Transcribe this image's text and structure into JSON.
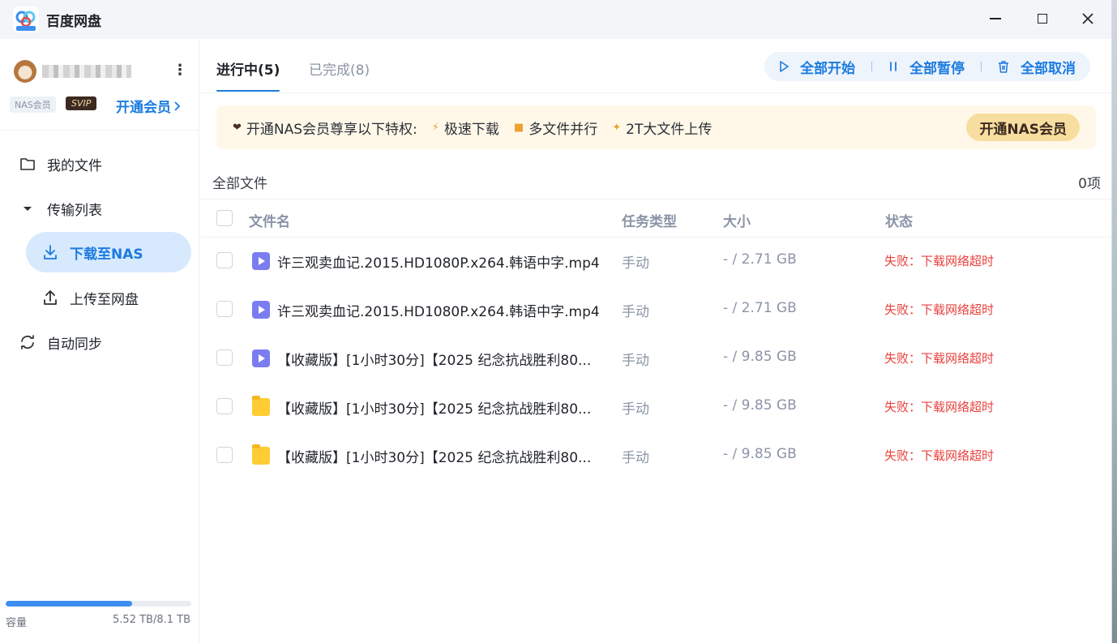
{
  "app": {
    "title": "百度网盘"
  },
  "user": {
    "badge_nas": "NAS会员",
    "badge_svip": "SVIP",
    "vip_link": "开通会员"
  },
  "sidebar": {
    "items": [
      {
        "label": "我的文件",
        "icon": "folder-icon"
      },
      {
        "label": "传输列表",
        "icon": "caret-down-icon"
      },
      {
        "label": "下载至NAS",
        "icon": "download-icon"
      },
      {
        "label": "上传至网盘",
        "icon": "upload-icon"
      },
      {
        "label": "自动同步",
        "icon": "sync-icon"
      }
    ],
    "storage": {
      "label": "容量",
      "value": "5.52 TB/8.1 TB",
      "used_fraction": 0.68
    }
  },
  "tabs": [
    {
      "label": "进行中(5)",
      "active": true
    },
    {
      "label": "已完成(8)",
      "active": false
    }
  ],
  "actions": {
    "start_all": "全部开始",
    "pause_all": "全部暂停",
    "cancel_all": "全部取消"
  },
  "promo": {
    "title": "开通NAS会员尊享以下特权:",
    "perks": [
      "极速下载",
      "多文件并行",
      "2T大文件上传"
    ],
    "button": "开通NAS会员"
  },
  "list": {
    "header": "全部文件",
    "count": "0项",
    "columns": [
      "文件名",
      "任务类型",
      "大小",
      "状态"
    ],
    "rows": [
      {
        "icon": "video",
        "name": "许三观卖血记.2015.HD1080P.x264.韩语中字.mp4",
        "type": "手动",
        "size": "- / 2.71 GB",
        "status": "失败：下载网络超时"
      },
      {
        "icon": "video",
        "name": "许三观卖血记.2015.HD1080P.x264.韩语中字.mp4",
        "type": "手动",
        "size": "- / 2.71 GB",
        "status": "失败：下载网络超时"
      },
      {
        "icon": "video",
        "name": "【收藏版】[1小时30分]【2025 纪念抗战胜利80...",
        "type": "手动",
        "size": "- / 9.85 GB",
        "status": "失败：下载网络超时"
      },
      {
        "icon": "folder",
        "name": "【收藏版】[1小时30分]【2025 纪念抗战胜利80...",
        "type": "手动",
        "size": "- / 9.85 GB",
        "status": "失败：下载网络超时"
      },
      {
        "icon": "folder",
        "name": "【收藏版】[1小时30分]【2025 纪念抗战胜利80...",
        "type": "手动",
        "size": "- / 9.85 GB",
        "status": "失败：下载网络超时"
      }
    ]
  },
  "colors": {
    "accent": "#1c7be0",
    "error": "#e8413c",
    "promo_bg": "#fff8e9"
  }
}
